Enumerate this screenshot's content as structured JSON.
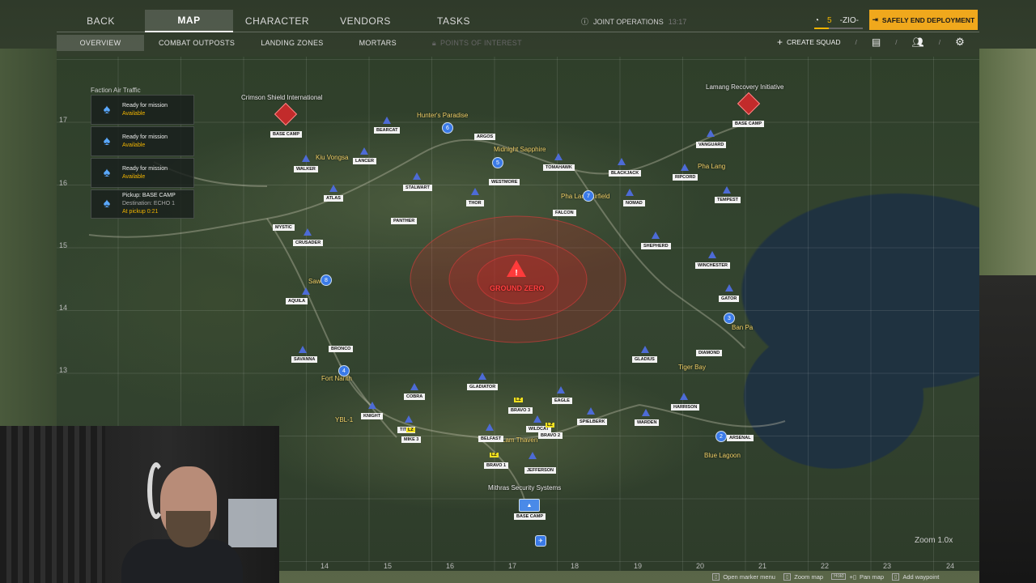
{
  "nav": {
    "tabs": [
      {
        "label": "BACK",
        "active": false
      },
      {
        "label": "MAP",
        "active": true
      },
      {
        "label": "CHARACTER",
        "active": false
      },
      {
        "label": "VENDORS",
        "active": false
      },
      {
        "label": "TASKS",
        "active": false
      }
    ],
    "subtabs": [
      {
        "label": "OVERVIEW",
        "active": true
      },
      {
        "label": "COMBAT OUTPOSTS"
      },
      {
        "label": "LANDING ZONES"
      },
      {
        "label": "MORTARS"
      },
      {
        "label": "POINTS OF INTEREST",
        "locked": true
      }
    ],
    "joint_ops": "JOINT OPERATIONS",
    "joint_time": "13:17",
    "credits": "5",
    "player": "-ZIO-",
    "safe_button": "SAFELY END DEPLOYMENT",
    "create_squad": "CREATE SQUAD"
  },
  "faction": {
    "title": "Faction Air Traffic",
    "cards": [
      {
        "num": "3",
        "line1": "Ready for mission",
        "line2": "Available"
      },
      {
        "num": "2",
        "line1": "Ready for mission",
        "line2": "Available"
      },
      {
        "num": "1",
        "line1": "Ready for mission",
        "line2": "Available"
      },
      {
        "num": "",
        "line1": "Pickup: BASE CAMP",
        "line2": "Destination: ECHO 1",
        "line3": "At pickup 0:21"
      }
    ]
  },
  "map": {
    "x_axis": [
      "14",
      "15",
      "16",
      "17",
      "18",
      "19",
      "20",
      "21",
      "22",
      "23",
      "24"
    ],
    "y_axis": [
      "17",
      "16",
      "15",
      "14",
      "13"
    ],
    "zoom": "Zoom 1.0x",
    "ground_zero": "GROUND ZERO",
    "places": [
      {
        "name": "Crimson Shield International",
        "white": true
      },
      {
        "name": "Lamang Recovery Initiative",
        "white": true
      },
      {
        "name": "Hunter's Paradise"
      },
      {
        "name": "Kiu Vongsa"
      },
      {
        "name": "Midnight Sapphire"
      },
      {
        "name": "Pha Lang"
      },
      {
        "name": "Pha Lang Airfield"
      },
      {
        "name": "Sawan"
      },
      {
        "name": "Fort Narith"
      },
      {
        "name": "YBL-1"
      },
      {
        "name": "Ban Pa"
      },
      {
        "name": "Tiger Bay"
      },
      {
        "name": "Blue Lagoon"
      },
      {
        "name": "Lam Thaven"
      },
      {
        "name": "Mithras Security Systems",
        "white": true
      }
    ],
    "labels": [
      "BASE CAMP",
      "BEARCAT",
      "ARGOS",
      "LANCER",
      "WALKER",
      "TOMAHAWK",
      "WESTMORE",
      "BLACKJACK",
      "RIPCORD",
      "VANGUARD",
      "BASE CAMP",
      "STALWART",
      "ATLAS",
      "THOR",
      "NOMAD",
      "FALCON",
      "TEMPEST",
      "PANTHER",
      "MYSTIC",
      "CRUSADER",
      "SHEPHERD",
      "WINCHESTER",
      "AQUILA",
      "GATOR",
      "BRONCO",
      "SAVANNA",
      "DIAMOND",
      "GLADIUS",
      "GLADIATOR",
      "COBRA",
      "EAGLE",
      "HARRISON",
      "KNIGHT",
      "BRAVO 3",
      "WILDCAT",
      "SPIELBERK",
      "WARDEN",
      "TITAN",
      "MIKE 3",
      "BELFAST",
      "BRAVO 2",
      "ARSENAL",
      "BRAVO 1",
      "JEFFERSON",
      "BASE CAMP"
    ]
  },
  "hints": [
    {
      "label": "Open marker menu"
    },
    {
      "label": "Zoom map"
    },
    {
      "key": "Hold",
      "label": "Pan map"
    },
    {
      "label": "Add waypoint"
    }
  ]
}
